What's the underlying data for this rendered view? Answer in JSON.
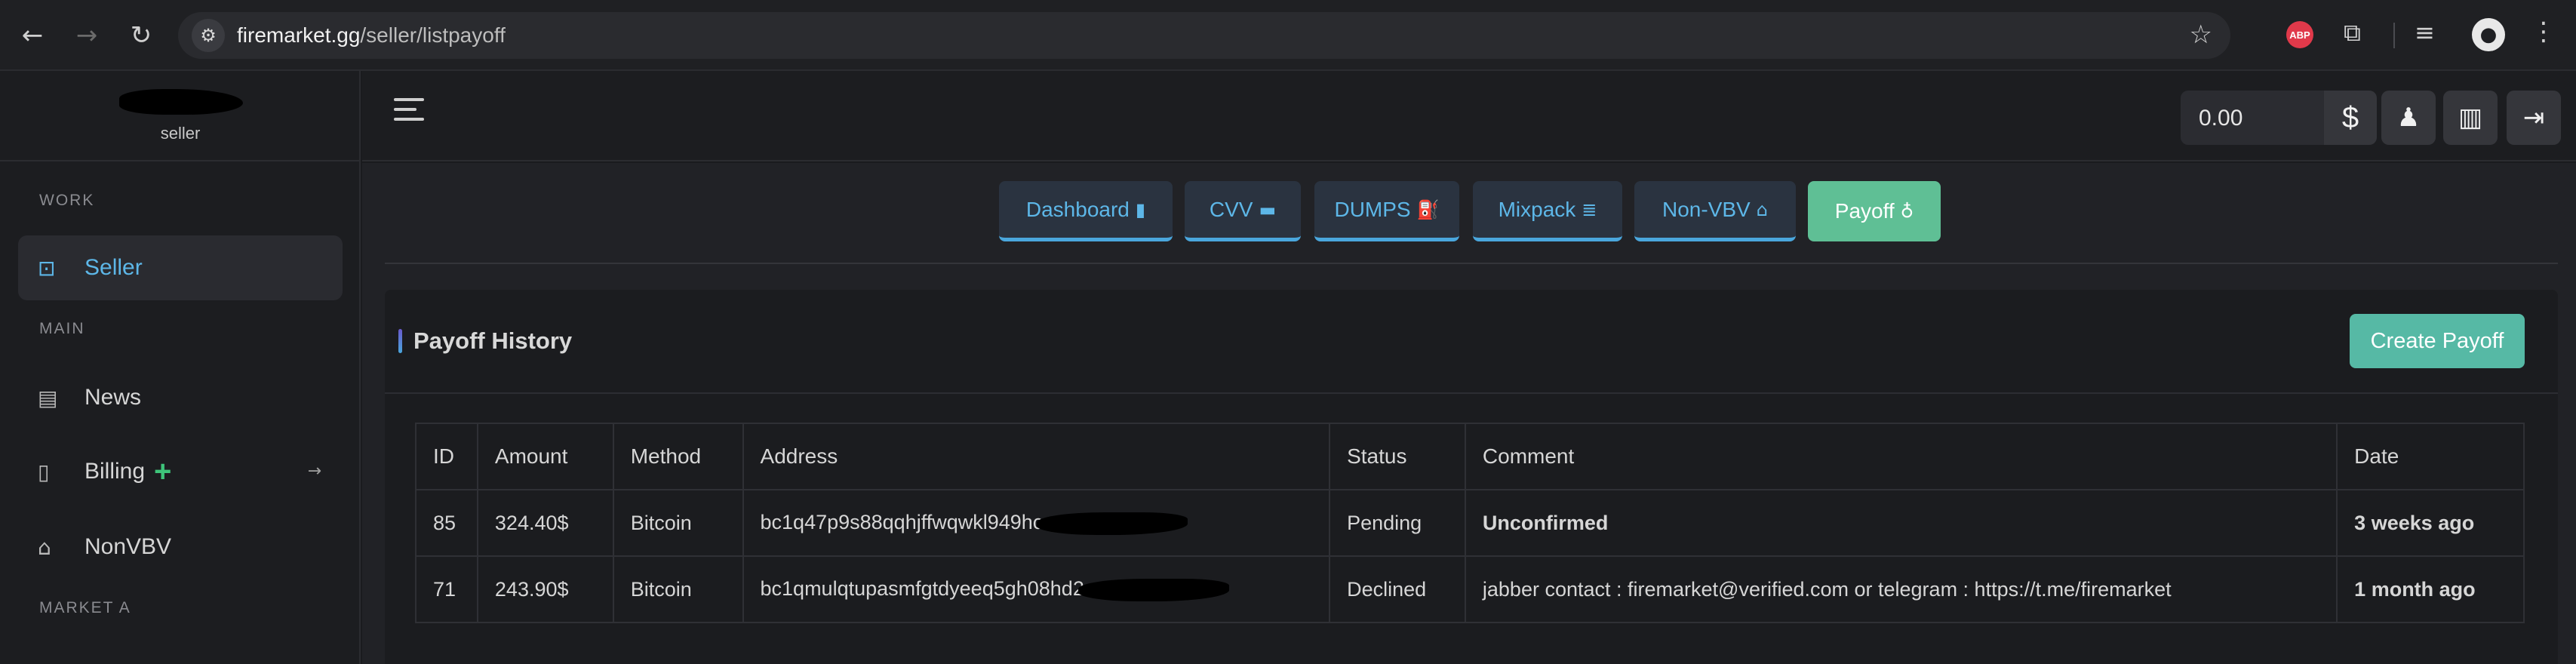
{
  "browser": {
    "url_host": "firemarket.gg",
    "url_path": "/seller/listpayoff",
    "icons": {
      "back": "back-arrow-icon",
      "forward": "forward-arrow-icon",
      "reload": "reload-icon",
      "star": "star-icon"
    },
    "abp_label": "ABP"
  },
  "sidebar": {
    "brand_sub": "seller",
    "sections": {
      "work": "WORK",
      "main": "MAIN",
      "market": "MARKET A"
    },
    "items": [
      {
        "label": "Seller",
        "icon": "briefcase-icon",
        "active": true
      },
      {
        "label": "News",
        "icon": "newspaper-icon"
      },
      {
        "label": "Billing",
        "icon": "invoice-icon",
        "badge": "+"
      },
      {
        "label": "NonVBV",
        "icon": "bank-icon"
      }
    ]
  },
  "header": {
    "balance": "0.00",
    "currency_symbol": "$"
  },
  "tabs": [
    {
      "label": "Dashboard",
      "icon": "bar-chart-icon"
    },
    {
      "label": "CVV",
      "icon": "credit-card-icon"
    },
    {
      "label": "DUMPS",
      "icon": "fuel-pump-icon"
    },
    {
      "label": "Mixpack",
      "icon": "database-icon"
    },
    {
      "label": "Non-VBV",
      "icon": "bank-icon"
    },
    {
      "label": "Payoff",
      "icon": "money-bag-icon",
      "active": true
    }
  ],
  "card": {
    "title": "Payoff History",
    "create_button": "Create Payoff"
  },
  "table": {
    "columns": [
      "ID",
      "Amount",
      "Method",
      "Address",
      "Status",
      "Comment",
      "Date"
    ],
    "rows": [
      {
        "id": "85",
        "amount": "324.40$",
        "method": "Bitcoin",
        "address": "bc1q47p9s88qqhjffwqwkl949hc",
        "status": "Pending",
        "comment": "Unconfirmed",
        "date": "3 weeks ago"
      },
      {
        "id": "71",
        "amount": "243.90$",
        "method": "Bitcoin",
        "address": "bc1qmulqtupasmfgtdyeeq5gh08hd2",
        "status": "Declined",
        "comment": "jabber contact : firemarket@verified.com or telegram : https://t.me/firemarket",
        "date": "1 month ago"
      }
    ]
  },
  "colors": {
    "accent": "#5db7e8",
    "active_tab": "#5fbf95",
    "pending": "#8c6cf0",
    "declined": "#e8604a"
  }
}
